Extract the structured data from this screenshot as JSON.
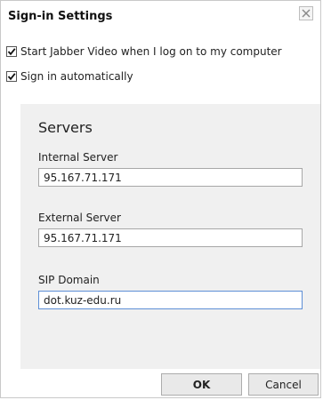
{
  "dialog": {
    "title": "Sign-in Settings",
    "close_icon": "close-icon"
  },
  "options": [
    {
      "label": "Start Jabber Video when I log on to my computer",
      "checked": true
    },
    {
      "label": "Sign in automatically",
      "checked": true
    }
  ],
  "servers": {
    "heading": "Servers",
    "internal_server": {
      "label": "Internal Server",
      "value": "95.167.71.171"
    },
    "external_server": {
      "label": "External Server",
      "value": "95.167.71.171"
    },
    "sip_domain": {
      "label": "SIP Domain",
      "value": "dot.kuz-edu.ru"
    }
  },
  "buttons": {
    "ok_label": "OK",
    "cancel_label": "Cancel"
  },
  "colors": {
    "panel_background": "#f0f0f0",
    "focus_border": "#5d8fd6"
  }
}
